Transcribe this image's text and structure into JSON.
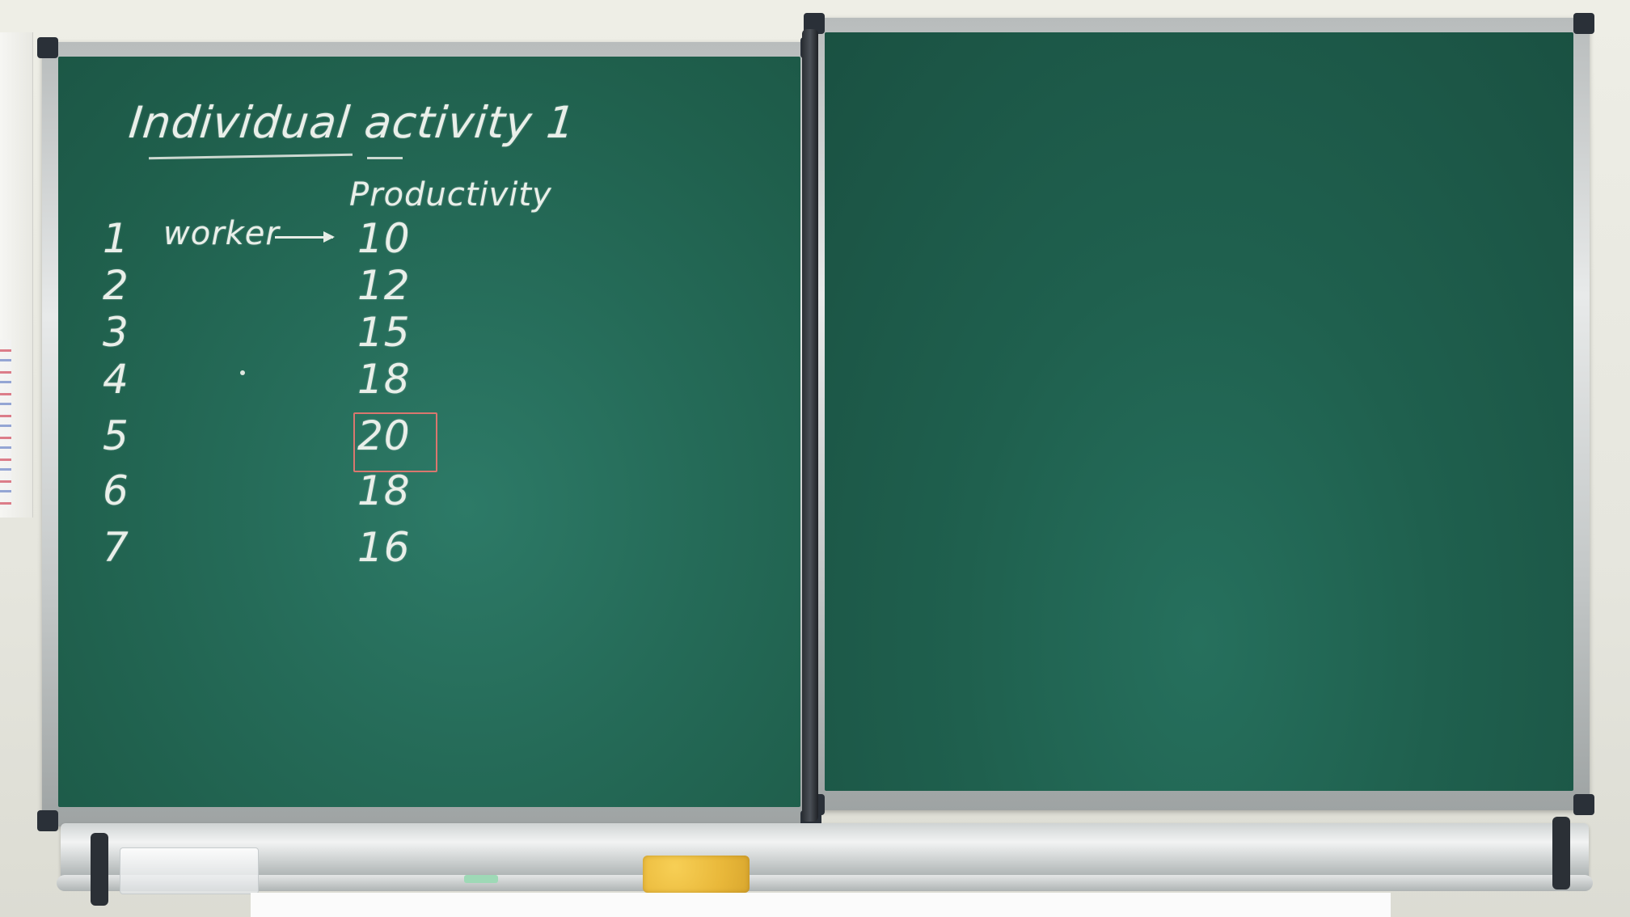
{
  "board": {
    "title": "Individual activity 1",
    "column_header": "Productivity",
    "worker_label": "worker",
    "rows": [
      {
        "n": "1",
        "value": "10"
      },
      {
        "n": "2",
        "value": "12"
      },
      {
        "n": "3",
        "value": "15"
      },
      {
        "n": "4",
        "value": "18"
      },
      {
        "n": "5",
        "value": "20"
      },
      {
        "n": "6",
        "value": "18"
      },
      {
        "n": "7",
        "value": "16"
      }
    ],
    "highlighted_row": "5"
  },
  "colors": {
    "chalkboard": "#256b58",
    "chalk": "#e9efe9",
    "highlight_box": "#d9776f",
    "sponge": "#e9b83a"
  }
}
